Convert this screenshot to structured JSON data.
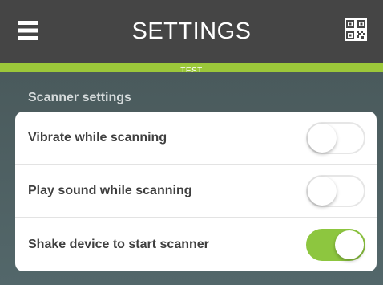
{
  "header": {
    "title": "SETTINGS",
    "menu_icon": "hamburger-menu-icon",
    "qr_icon": "qr-code-icon",
    "background": "#454545"
  },
  "environment": {
    "label": "TEST",
    "color": "#9cc83a"
  },
  "section": {
    "title": "Scanner settings"
  },
  "settings": [
    {
      "label": "Vibrate while scanning",
      "enabled": false
    },
    {
      "label": "Play sound while scanning",
      "enabled": false
    },
    {
      "label": "Shake device to start scanner",
      "enabled": true
    }
  ],
  "colors": {
    "toggle_on": "#8dc63f",
    "page_background": "#4c5c5e"
  }
}
